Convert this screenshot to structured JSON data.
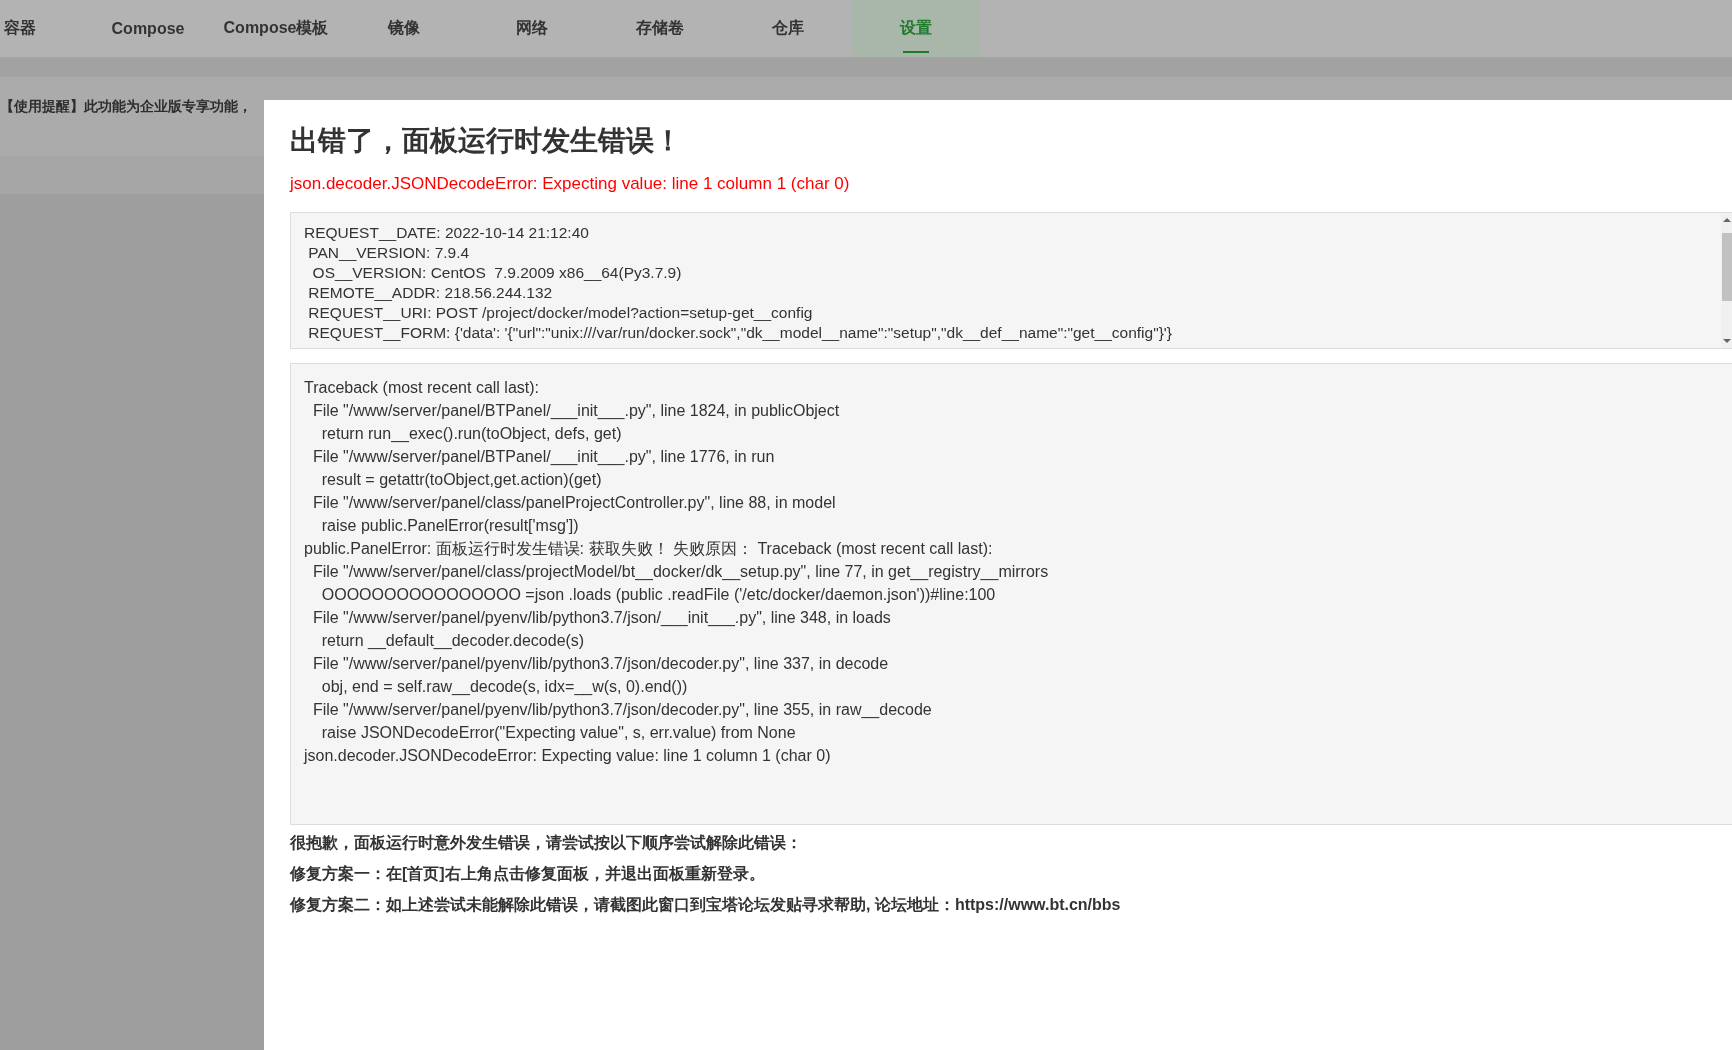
{
  "tabs": [
    {
      "label": "容器",
      "selected": false
    },
    {
      "label": "Compose",
      "selected": false
    },
    {
      "label": "Compose模板",
      "selected": false
    },
    {
      "label": "镜像",
      "selected": false
    },
    {
      "label": "网络",
      "selected": false
    },
    {
      "label": "存储卷",
      "selected": false
    },
    {
      "label": "仓库",
      "selected": false
    },
    {
      "label": "设置",
      "selected": true
    }
  ],
  "notice": "【使用提醒】此功能为企业版专享功能，",
  "error_dialog": {
    "title": "出错了，面板运行时发生错误！",
    "error": "json.decoder.JSONDecodeError: Expecting value: line 1 column 1 (char 0)",
    "request_info": [
      "REQUEST__DATE: 2022-10-14 21:12:40",
      " PAN__VERSION: 7.9.4",
      "  OS__VERSION: CentOS  7.9.2009 x86__64(Py3.7.9)",
      " REMOTE__ADDR: 218.56.244.132",
      " REQUEST__URI: POST /project/docker/model?action=setup-get__config",
      " REQUEST__FORM: {'data': '{\"url\":\"unix:///var/run/docker.sock\",\"dk__model__name\":\"setup\",\"dk__def__name\":\"get__config\"}'}"
    ],
    "traceback": [
      "Traceback (most recent call last):",
      "  File \"/www/server/panel/BTPanel/___init___.py\", line 1824, in publicObject",
      "    return run__exec().run(toObject, defs, get)",
      "  File \"/www/server/panel/BTPanel/___init___.py\", line 1776, in run",
      "    result = getattr(toObject,get.action)(get)",
      "  File \"/www/server/panel/class/panelProjectController.py\", line 88, in model",
      "    raise public.PanelError(result['msg'])",
      "public.PanelError: 面板运行时发生错误: 获取失败！ 失败原因： Traceback (most recent call last):",
      "  File \"/www/server/panel/class/projectModel/bt__docker/dk__setup.py\", line 77, in get__registry__mirrors",
      "    OOOOOOOOOOOOOOOO =json .loads (public .readFile ('/etc/docker/daemon.json'))#line:100",
      "  File \"/www/server/panel/pyenv/lib/python3.7/json/___init___.py\", line 348, in loads",
      "    return __default__decoder.decode(s)",
      "  File \"/www/server/panel/pyenv/lib/python3.7/json/decoder.py\", line 337, in decode",
      "    obj, end = self.raw__decode(s, idx=__w(s, 0).end())",
      "  File \"/www/server/panel/pyenv/lib/python3.7/json/decoder.py\", line 355, in raw__decode",
      "    raise JSONDecodeError(\"Expecting value\", s, err.value) from None",
      "json.decoder.JSONDecodeError: Expecting value: line 1 column 1 (char 0)"
    ],
    "help": [
      "很抱歉，面板运行时意外发生错误，请尝试按以下顺序尝试解除此错误：",
      "修复方案一：在[首页]右上角点击修复面板，并退出面板重新登录。",
      "修复方案二：如上述尝试未能解除此错误，请截图此窗口到宝塔论坛发贴寻求帮助, 论坛地址：https://www.bt.cn/bbs"
    ]
  }
}
